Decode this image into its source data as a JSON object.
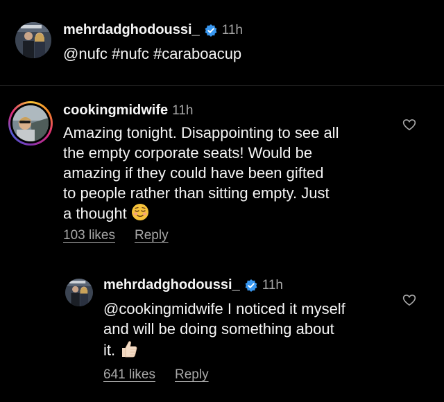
{
  "caption": {
    "username": "mehrdadghodoussi_",
    "verified": true,
    "time": "11h",
    "text": "@nufc #nufc #caraboacup"
  },
  "comment": {
    "username": "cookingmidwife",
    "time": "11h",
    "lines": [
      "Amazing tonight. Disappointing to see all",
      "the empty corporate seats!  Would be",
      "amazing if they could have been gifted",
      "to people rather than sitting empty. Just",
      "a thought"
    ],
    "emoji": "relieved-smiling-face",
    "likes": "103 likes",
    "reply_label": "Reply",
    "like_icon": "heart-outline-icon"
  },
  "reply": {
    "username": "mehrdadghodoussi_",
    "verified": true,
    "time": "11h",
    "lines": [
      "@cookingmidwife I noticed it myself",
      "and will be doing something about",
      "it."
    ],
    "emoji": "thumbs-up",
    "likes": "641 likes",
    "reply_label": "Reply",
    "like_icon": "heart-outline-icon"
  },
  "colors": {
    "background": "#000000",
    "text": "#f5f5f5",
    "secondary": "#a8a8a8",
    "verified_badge": "#3897f0"
  }
}
